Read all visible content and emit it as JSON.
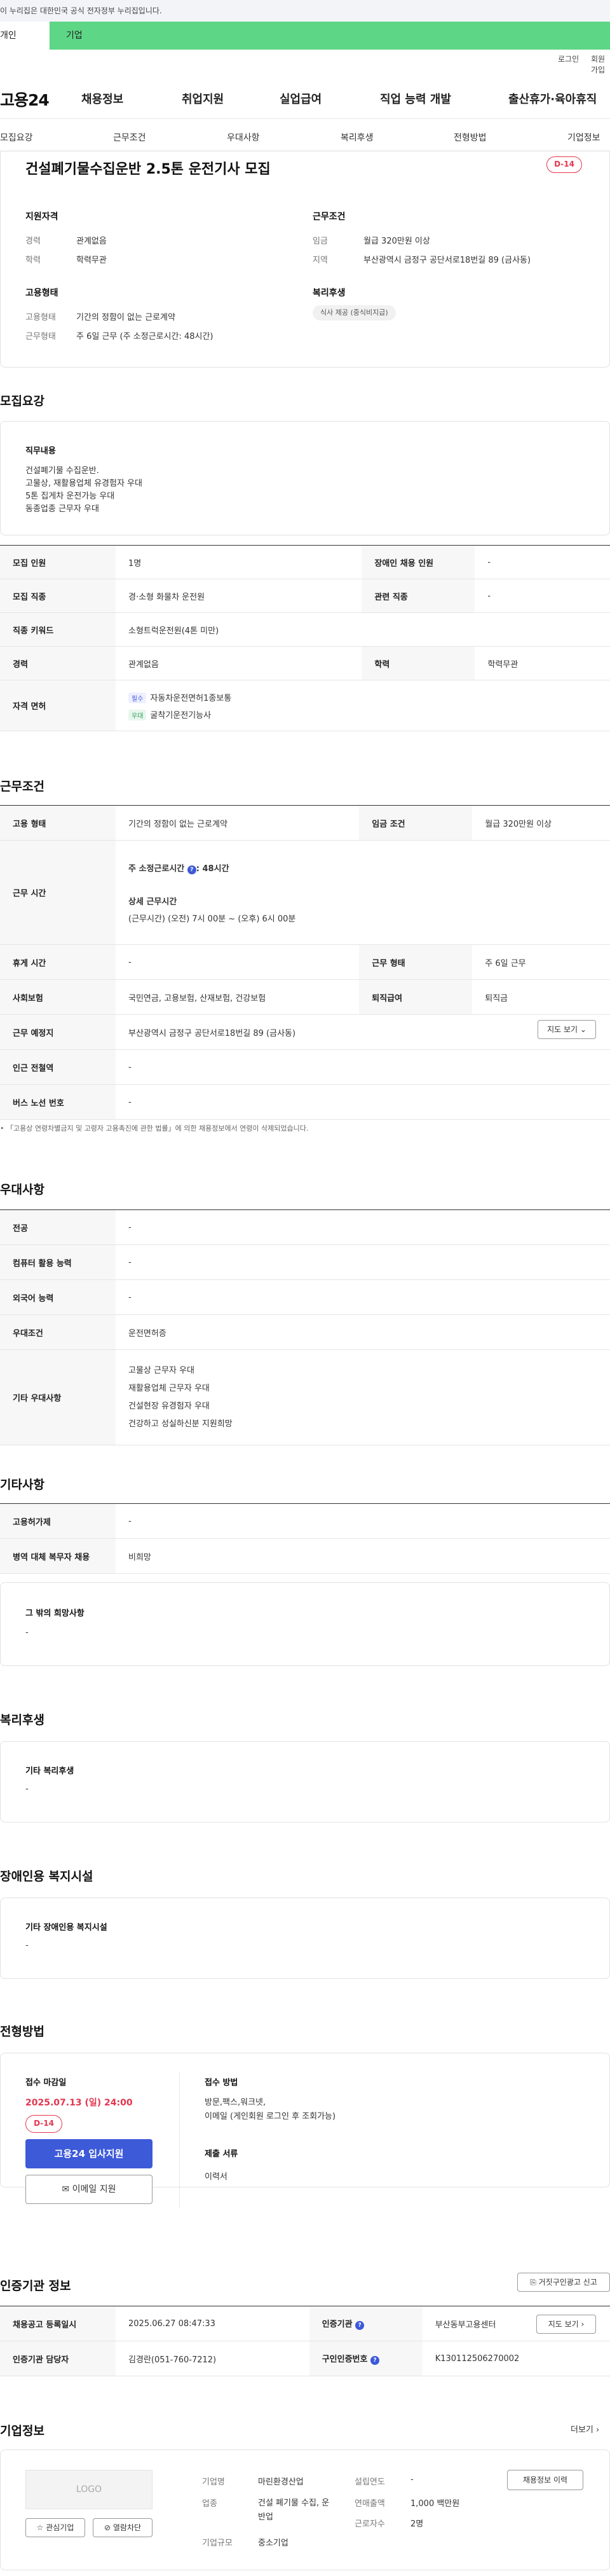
{
  "gov_banner": "이 누리집은 대한민국 공식 전자정부 누리집입니다.",
  "top_tabs": [
    "개인",
    "기업"
  ],
  "util": {
    "login": "로그인",
    "join": "회원가입"
  },
  "site": {
    "logo": "고용24",
    "nav": [
      "채용정보",
      "취업지원",
      "실업급여",
      "직업 능력 개발",
      "출산휴가·육아휴직"
    ]
  },
  "subnav": [
    "모집요강",
    "근무조건",
    "우대사항",
    "복리후생",
    "전형방법",
    "기업정보"
  ],
  "job": {
    "title": "건설폐기물수집운반 2.5톤 운전기사 모집",
    "dday": "D-14"
  },
  "summary": {
    "support_title": "지원자격",
    "support": [
      [
        "경력",
        "관계없음"
      ],
      [
        "학력",
        "학력무관"
      ]
    ],
    "cond_title": "근무조건",
    "cond": [
      [
        "임금",
        "월급 320만원 이상"
      ],
      [
        "지역",
        "부산광역시 금정구 공단서로18번길 89 (금사동)"
      ]
    ],
    "emp_title": "고용형태",
    "emp": [
      [
        "고용형태",
        "기간의 정함이 없는 근로계약"
      ],
      [
        "근무형태",
        "주 6일 근무 (주 소정근로시간: 48시간)"
      ]
    ],
    "welfare_title": "복리후생",
    "welfare_chip": "식사 제공 (중식비지급)"
  },
  "recruit": {
    "section": "모집요강",
    "duty_title": "직무내용",
    "duty_lines": [
      "건설폐기물 수집운반.",
      "고물상, 재활용업체 유경험자 우대",
      "5톤 집게차 운전가능 우대",
      "동종업종 근무자 우대"
    ],
    "rows": [
      [
        "모집 인원",
        "1명",
        "장애인 채용 인원",
        "-"
      ],
      [
        "모집 직종",
        "경·소형 화물차 운전원",
        "관련 직종",
        "-"
      ],
      [
        "직종 키워드",
        "소형트럭운전원(4톤 미만)",
        "",
        ""
      ],
      [
        "경력",
        "관계없음",
        "학력",
        "학력무관"
      ]
    ],
    "license_label": "자격 면허",
    "licenses": [
      [
        "필수",
        "자동차운전면허1종보통"
      ],
      [
        "우대",
        "굴착기운전기능사"
      ]
    ]
  },
  "work": {
    "section": "근무조건",
    "emp_type": [
      "고용 형태",
      "기간의 정함이 없는 근로계약",
      "임금 조건",
      "월급 320만원 이상"
    ],
    "hours_label": "근무 시간",
    "hours_main": "주 소정근로시간",
    "hours_val": "48시간",
    "detail_title": "상세 근무시간",
    "detail": "(근무시간) (오전) 7시 00분 ~ (오후) 6시 00분",
    "rest": [
      "휴게 시간",
      "-",
      "근무 형태",
      "주 6일 근무"
    ],
    "ins": [
      "사회보험",
      "국민연금, 고용보험, 산재보험, 건강보험",
      "퇴직급여",
      "퇴직금"
    ],
    "place_label": "근무 예정지",
    "place": "부산광역시 금정구 공단서로18번길 89 (금사동)",
    "map_btn": "지도 보기",
    "subway": [
      "인근 전철역",
      "-"
    ],
    "bus": [
      "버스 노선 번호",
      "-"
    ],
    "notice": "「고용상 연령차별금지 및 고령자 고용촉진에 관한 법률」에 의한 채용정보에서 연령이 삭제되었습니다."
  },
  "pref": {
    "section": "우대사항",
    "rows": [
      [
        "전공",
        "-"
      ],
      [
        "컴퓨터 활용 능력",
        "-"
      ],
      [
        "외국어 능력",
        "-"
      ],
      [
        "우대조건",
        "운전면허증"
      ]
    ],
    "other_label": "기타 우대사항",
    "other": [
      "고물상 근무자 우대",
      "재활용업체 근무자 우대",
      "건설현장 유경험자 우대",
      "건강하고 성실하신분 지원희망"
    ]
  },
  "etc": {
    "section": "기타사항",
    "rows": [
      [
        "고용허가제",
        "-"
      ],
      [
        "병역 대체 복무자 채용",
        "비희망"
      ]
    ],
    "hope_title": "그 밖의 희망사항",
    "hope": "-"
  },
  "welfare": {
    "section": "복리후생",
    "title": "기타 복리후생",
    "val": "-"
  },
  "disabled": {
    "section": "장애인용 복지시설",
    "title": "기타 장애인용 복지시설",
    "val": "-"
  },
  "process": {
    "section": "전형방법",
    "deadline_title": "접수 마감일",
    "deadline": "2025.07.13 (일) 24:00",
    "dday": "D-14",
    "apply_btn": "고용24 입사지원",
    "email_btn": "이메일 지원",
    "method_title": "접수 방법",
    "method_lines": [
      "방문,팩스,워크넷,",
      "이메일 (게인회원 로그인 후 조회가능)"
    ],
    "doc_title": "제출 서류",
    "doc": "이력서"
  },
  "cert": {
    "section": "인증기관 정보",
    "report_btn": "거짓구인광고 신고",
    "rows": [
      [
        "채용공고 등록일시",
        "2025.06.27 08:47:33",
        "인증기관",
        "부산동부고용센터"
      ],
      [
        "인증기관 담당자",
        "김경란(051-760-7212)",
        "구인인증번호",
        "K130112506270002"
      ]
    ],
    "map_btn": "지도 보기"
  },
  "company": {
    "section": "기업정보",
    "more": "더보기",
    "logo": "LOGO",
    "fav": "관심기업",
    "block": "열람차단",
    "rows": [
      [
        "기업명",
        "마린환경산업",
        "설립연도",
        "-"
      ],
      [
        "업종",
        "건설 폐기물 수집, 운반업",
        "연매출액",
        "1,000 백만원"
      ],
      [
        "기업규모",
        "중소기업",
        "근로자수",
        "2명"
      ]
    ],
    "jobs_btn": "채용정보 이력"
  }
}
